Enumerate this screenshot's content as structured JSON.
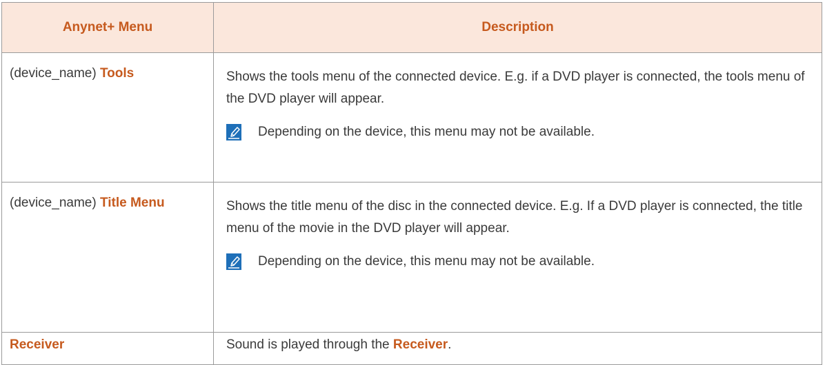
{
  "table": {
    "headers": {
      "col1": "Anynet+ Menu",
      "col2": "Description"
    },
    "rows": [
      {
        "name_prefix": "(device_name) ",
        "name_highlight": "Tools",
        "description": "Shows the tools menu of the connected device. E.g. if a DVD player is connected, the tools menu of the DVD player will appear.",
        "note": "Depending on the device, this menu may not be available."
      },
      {
        "name_prefix": "(device_name) ",
        "name_highlight": "Title Menu",
        "description": "Shows the title menu of the disc in the connected device. E.g. If a DVD player is connected, the title menu of the movie in the DVD player will appear.",
        "note": "Depending on the device, this menu may not be available."
      },
      {
        "name_prefix": "",
        "name_highlight": "Receiver",
        "description_prefix": "Sound is played through the ",
        "description_highlight": "Receiver",
        "description_suffix": "."
      }
    ]
  },
  "icons": {
    "note": "note-pencil-icon"
  },
  "colors": {
    "header_bg": "#fbe7dc",
    "accent": "#c65a1e",
    "icon_blue": "#1e6fb8",
    "border": "#9a9a9a"
  }
}
